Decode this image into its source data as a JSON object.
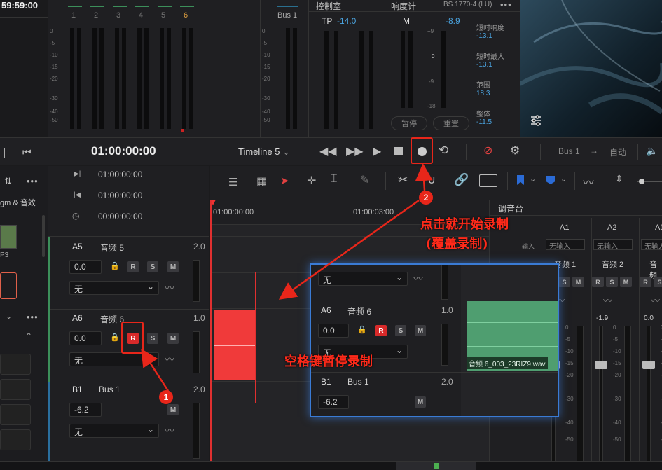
{
  "timecode_top": "59:59:00",
  "meter_channels": [
    "1",
    "2",
    "3",
    "4",
    "5",
    "6"
  ],
  "meter_scale": [
    "0",
    "-5",
    "-10",
    "-15",
    "-20",
    "-30",
    "-40",
    "-50"
  ],
  "bus_label": "Bus 1",
  "control_room": {
    "title": "控制室",
    "tp_label": "TP",
    "tp_value": "-14.0"
  },
  "loudness": {
    "title": "响度计",
    "standard": "BS.1770-4 (LU)",
    "m_label": "M",
    "m_value": "-8.9",
    "scale": [
      "+9",
      "0",
      "-9",
      "-18"
    ],
    "short_label": "短时响度",
    "short_value": "-13.1",
    "short_max_label": "短时最大",
    "short_max_value": "-13.1",
    "range_label": "范围",
    "range_value": "18.3",
    "integrated_label": "整体",
    "integrated_value": "-11.5",
    "pause_btn": "暂停",
    "reset_btn": "重置"
  },
  "transport": {
    "timecode": "01:00:00:00",
    "timeline_name": "Timeline 5",
    "bus": "Bus 1",
    "auto": "自动"
  },
  "left_panel": {
    "media_label": "gm & 音效",
    "clip_label": "P3"
  },
  "tc_rows": [
    "01:00:00:00",
    "01:00:00:00",
    "00:00:00:00"
  ],
  "ruler": {
    "t1": "01:00:00:00",
    "t2": "01:00:03:00"
  },
  "tracks": [
    {
      "id": "A5",
      "name": "音频 5",
      "ch": "2.0",
      "vol": "0.0",
      "input": "无"
    },
    {
      "id": "A6",
      "name": "音频 6",
      "ch": "1.0",
      "vol": "0.0",
      "input": "无"
    },
    {
      "id": "B1",
      "name": "Bus 1",
      "ch": "2.0",
      "vol": "-6.2",
      "input": "无"
    }
  ],
  "btn_r": "R",
  "btn_s": "S",
  "btn_m": "M",
  "zoom_panel": {
    "track_id": "A6",
    "track_name": "音频 6",
    "ch": "1.0",
    "vol": "0.0",
    "input": "无",
    "bus_id": "B1",
    "bus_name": "Bus 1",
    "bus_ch": "2.0",
    "bus_vol": "-6.2",
    "clip_name": "音频 6_003_23RIZ9.wav"
  },
  "mixer": {
    "title": "调音台",
    "input_label": "输入",
    "channels": [
      {
        "id": "A1",
        "input": "无输入",
        "name": "音频 1",
        "val": ""
      },
      {
        "id": "A2",
        "input": "无输入",
        "name": "音频 2",
        "val": "-1.9"
      },
      {
        "id": "A3",
        "input": "无输入",
        "name": "音频",
        "val": "0.0"
      }
    ],
    "scale": [
      "0",
      "-5",
      "-10",
      "-15",
      "-20",
      "-30",
      "-40",
      "-50"
    ]
  },
  "annotations": {
    "step1": "1",
    "step2": "2",
    "click_text": "点击就开始录制",
    "overwrite_text": "(覆盖录制)",
    "space_text": "空格键暂停录制"
  },
  "colors": {
    "record_red": "#d82a2a",
    "annot_red": "#e8261a",
    "clip_green": "#4f9e70",
    "zoom_border": "#3a7bd5",
    "accent_blue": "#4aa3df"
  }
}
